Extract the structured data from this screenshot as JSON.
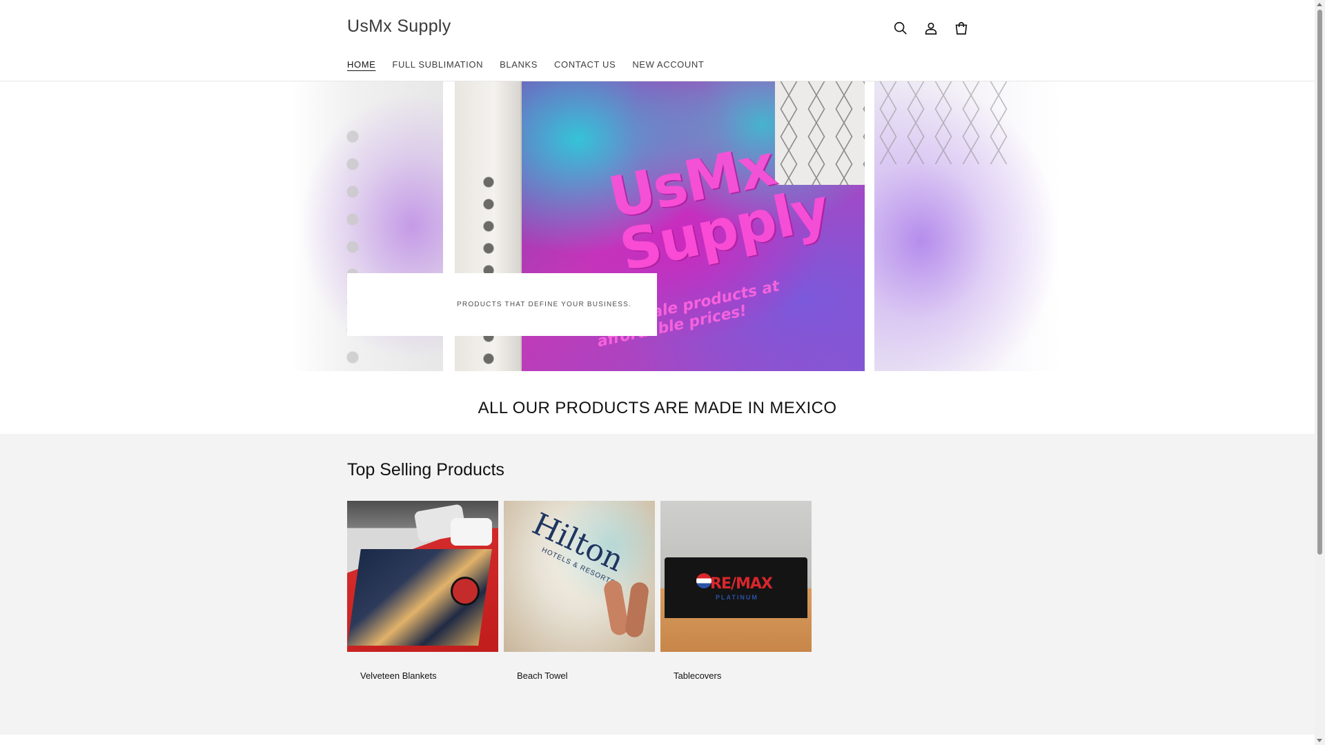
{
  "header": {
    "logo": "UsMx Supply",
    "icons": [
      "search-icon",
      "account-icon",
      "cart-icon"
    ],
    "nav": [
      {
        "label": "HOME",
        "active": true
      },
      {
        "label": "FULL SUBLIMATION",
        "active": false
      },
      {
        "label": "BLANKS",
        "active": false
      },
      {
        "label": "CONTACT US",
        "active": false
      },
      {
        "label": "NEW ACCOUNT",
        "active": false
      }
    ]
  },
  "hero": {
    "image_text_line1": "UsMx",
    "image_text_line2": "Supply",
    "image_tagline": "wholesale products at affordable prices!",
    "caption": "PRODUCTS THAT DEFINE YOUR BUSINESS."
  },
  "headline": "ALL OUR PRODUCTS ARE MADE IN MEXICO",
  "products": {
    "title": "Top Selling Products",
    "items": [
      {
        "label": "Velveteen Blankets"
      },
      {
        "label": "Beach Towel",
        "image_text": "Hilton",
        "image_subtext": "HOTELS & RESORTS"
      },
      {
        "label": "Tablecovers",
        "image_text": "RE/MAX",
        "image_subtext": "PLATINUM"
      }
    ]
  },
  "colors": {
    "text": "#121212",
    "section_bg": "#f3f3f3",
    "accent_magenta": "#ff4fd8",
    "brand_navy": "#1e3560",
    "remax_red": "#d9262c",
    "remax_blue": "#2a52a6"
  }
}
